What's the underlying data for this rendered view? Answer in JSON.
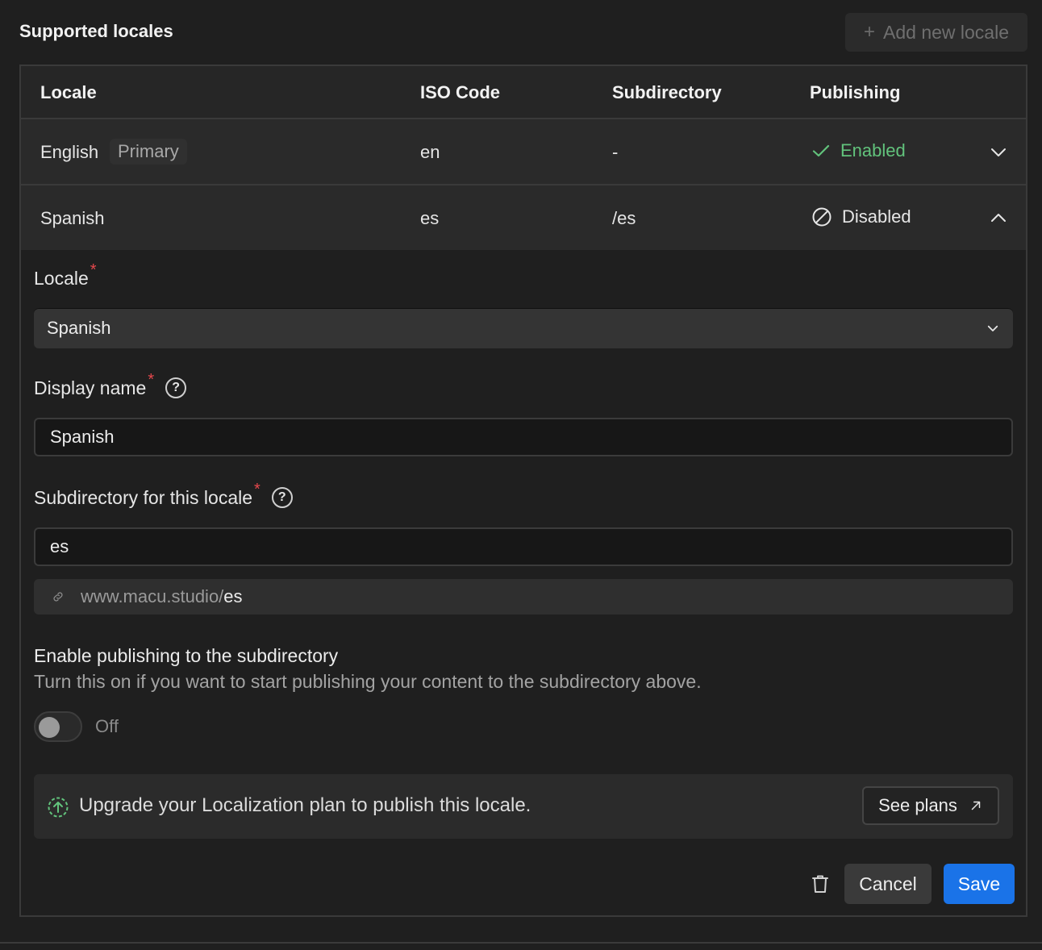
{
  "header": {
    "title": "Supported locales",
    "add_button_label": "Add new locale",
    "add_button_icon": "plus-icon"
  },
  "table": {
    "columns": [
      "Locale",
      "ISO Code",
      "Subdirectory",
      "Publishing"
    ],
    "rows": [
      {
        "locale": "English",
        "badge": "Primary",
        "iso": "en",
        "subdirectory": "-",
        "publishing": "Enabled",
        "status_icon": "check-icon",
        "expanded": false
      },
      {
        "locale": "Spanish",
        "badge": "",
        "iso": "es",
        "subdirectory": "/es",
        "publishing": "Disabled",
        "status_icon": "disabled-circle-icon",
        "expanded": true
      }
    ]
  },
  "form": {
    "locale_label": "Locale",
    "locale_value": "Spanish",
    "display_name_label": "Display name",
    "display_name_value": "Spanish",
    "subdirectory_label": "Subdirectory for this locale",
    "subdirectory_value": "es",
    "required_mark": "*",
    "help_glyph": "?",
    "url_host": "www.macu.studio/",
    "url_path": "es",
    "publish_title": "Enable publishing to the subdirectory",
    "publish_desc": "Turn this on if you want to start publishing your content to the subdirectory above.",
    "toggle_state": "Off"
  },
  "upgrade": {
    "message": "Upgrade your Localization plan to publish this locale.",
    "button_label": "See plans"
  },
  "actions": {
    "cancel_label": "Cancel",
    "save_label": "Save"
  },
  "colors": {
    "accent": "#1a73e8",
    "enabled": "#62c37c",
    "required": "#e5484d"
  }
}
